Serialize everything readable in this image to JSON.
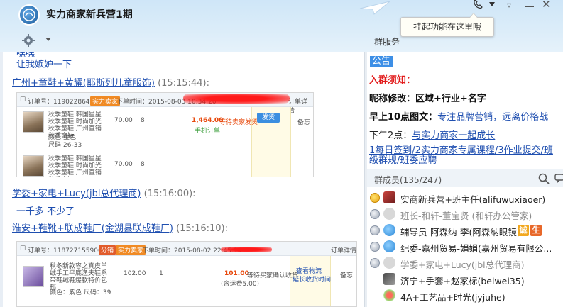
{
  "app": {
    "group_title": "实力商家新兵营1期",
    "tooltip": "挂起功能在这里哦",
    "group_service": "群服务"
  },
  "chat": {
    "top_partial": "嘿嘿",
    "line1": "让我嫉妒一下",
    "msg1": {
      "sender": "广州+童鞋+黄耀(耶斯列儿童服饰)",
      "time": "(15:15:44):"
    },
    "order1": {
      "order_no": "订单号：1190228642387807",
      "tag": "实力卖家",
      "time_label": "下单时间：2015-08-03 10:34:20",
      "right_label": "订单详情",
      "items": [
        {
          "desc": "秋季童鞋 韩国星星秋季童鞋 时尚加光秋季童鞋 广州直销 秋季童鞋",
          "attr1": "颜色:金色",
          "attr2": "尺码:26-33",
          "price": "70.00",
          "qty": "8"
        },
        {
          "desc": "秋季童鞋 韩国星星秋季童鞋 时尚加光秋季童鞋 广州直销 秋季童鞋",
          "attr1": "",
          "attr2": "",
          "price": "70.00",
          "qty": "8"
        }
      ],
      "total": "1,464.00",
      "total_sub": "手机订单",
      "status": "等待卖家发货",
      "action": "发货",
      "note": "备忘"
    },
    "msg2": {
      "sender": "学委+家电+Lucy(jbl总代理商)",
      "time": "(15:16:00):"
    },
    "line2": "一千多 不少了",
    "msg3": {
      "sender": "淮安+鞋靴+联成鞋厂(金湖县联成鞋厂)",
      "time": "(15:16:10):"
    },
    "order2": {
      "order_no": "订单号：1187271559007119",
      "tag1": "分销",
      "tag2": "实力卖家",
      "time_label": "下单时间：2015-08-02 22:45:14",
      "right_label": "订单详情",
      "item": {
        "desc": "秋冬新款容之真皮羊绒手工平底渔夫鞋系带鞋绒鞋爆款特价包邮",
        "attr": "颜色：紫色    尺码：39",
        "price": "102.00",
        "qty": "1"
      },
      "total": "101.00",
      "total_sub": "(含运费5.00)",
      "status": "等待买家确认收货",
      "action1": "查看物流",
      "action2": "延长收货时间",
      "note": "备忘"
    }
  },
  "notice": {
    "tab": "公告",
    "title": "入群须知：",
    "rename_label": "昵称修改：",
    "rename_value": "区域+行业+名字",
    "morning_label": "早上10点图文：",
    "morning_link": "专注品牌营销，远离价格战",
    "afternoon_label": "下午2点：",
    "afternoon_link": "与实力商家一起成长",
    "tasks": "1每日签到/2实力商家专属课程/3作业提交/班级群规/班委应聘"
  },
  "members": {
    "label": "群成员(135/247)",
    "list": [
      {
        "medal": "gold",
        "avatar": "red",
        "name": "实商新兵营+班主任(alifuwuxiaoer)",
        "gray": false
      },
      {
        "medal": "silver",
        "avatar": "gray",
        "name": "班长-和轩-董宝贤 (和轩办公管家)",
        "gray": true
      },
      {
        "medal": "silver",
        "avatar": "blue",
        "name": "辅导员-阿森纳-李(阿森纳眼镜)",
        "gray": false,
        "badges": [
          "诚",
          "生"
        ]
      },
      {
        "medal": "silver",
        "avatar": "blue",
        "name": "纪委-嘉州贸易-娟娟(嘉州贸易有限公...",
        "gray": false
      },
      {
        "medal": "silver",
        "avatar": "gray",
        "name": "学委+家电+Lucy(jbl总代理商)",
        "gray": true
      },
      {
        "medal": "",
        "avatar": "dark",
        "name": "济宁+手套+赵家标(beiwei35)",
        "gray": false
      },
      {
        "medal": "",
        "avatar": "flower",
        "name": "4A+工艺品+时光(jyjuhe)",
        "gray": false
      }
    ]
  },
  "colors": {
    "header_bg": "#d6eaf9",
    "link_blue": "#1f4fb0",
    "notice_red": "#e21b1b",
    "tab_blue": "#3d8fe6"
  }
}
